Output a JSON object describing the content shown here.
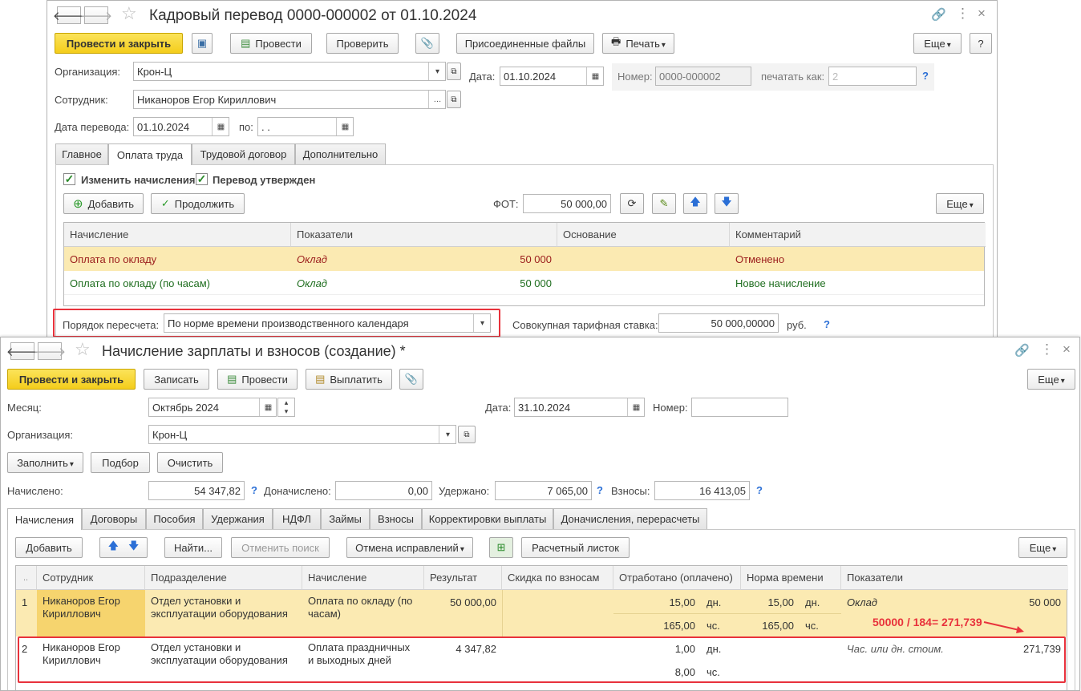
{
  "w1": {
    "title": "Кадровый перевод 0000-000002 от 01.10.2024",
    "toolbar": {
      "post_close": "Провести и закрыть",
      "post": "Провести",
      "check": "Проверить",
      "attached": "Присоединенные файлы",
      "print": "Печать",
      "more": "Еще",
      "help": "?"
    },
    "org_label": "Организация:",
    "org_value": "Крон-Ц",
    "date_label": "Дата:",
    "date_value": "01.10.2024",
    "number_label": "Номер:",
    "number_value": "0000-000002",
    "print_as_label": "печатать как:",
    "print_as_value": "2",
    "employee_label": "Сотрудник:",
    "employee_value": "Никаноров Егор Кириллович",
    "transfer_date_label": "Дата перевода:",
    "transfer_date_value": "01.10.2024",
    "to_label": "по:",
    "to_value": "  .  .",
    "tabs": [
      "Главное",
      "Оплата труда",
      "Трудовой договор",
      "Дополнительно"
    ],
    "change_accruals": "Изменить начисления",
    "transfer_approved": "Перевод утвержден",
    "add": "Добавить",
    "continue": "Продолжить",
    "fot_label": "ФОТ:",
    "fot_value": "50 000,00",
    "more": "Еще",
    "columns": [
      "Начисление",
      "Показатели",
      "Основание",
      "Комментарий"
    ],
    "rows": [
      {
        "accrual": "Оплата по окладу",
        "indicator": "Оклад",
        "amount": "50 000",
        "basis": "",
        "comment": "Отменено",
        "color": "#9b1c1c"
      },
      {
        "accrual": "Оплата по окладу (по часам)",
        "indicator": "Оклад",
        "amount": "50 000",
        "basis": "",
        "comment": "Новое начисление",
        "color": "#1f6e1f"
      }
    ],
    "recalc_label": "Порядок пересчета:",
    "recalc_value": "По норме времени производственного календаря",
    "rate_label": "Совокупная тарифная ставка:",
    "rate_value": "50 000,00000",
    "rate_unit": "руб.",
    "help": "?"
  },
  "w2": {
    "title": "Начисление зарплаты и взносов (создание) *",
    "toolbar": {
      "post_close": "Провести и закрыть",
      "save": "Записать",
      "post": "Провести",
      "pay": "Выплатить",
      "more": "Еще"
    },
    "month_label": "Месяц:",
    "month_value": "Октябрь 2024",
    "date_label": "Дата:",
    "date_value": "31.10.2024",
    "number_label": "Номер:",
    "number_value": "",
    "org_label": "Организация:",
    "org_value": "Крон-Ц",
    "fill": "Заполнить",
    "select": "Подбор",
    "clear": "Очистить",
    "accrued_label": "Начислено:",
    "accrued_value": "54 347,82",
    "extra_label": "Доначислено:",
    "extra_value": "0,00",
    "withheld_label": "Удержано:",
    "withheld_value": "7 065,00",
    "contrib_label": "Взносы:",
    "contrib_value": "16 413,05",
    "help": "?",
    "tabs": [
      "Начисления",
      "Договоры",
      "Пособия",
      "Удержания",
      "НДФЛ",
      "Займы",
      "Взносы",
      "Корректировки выплаты",
      "Доначисления, перерасчеты"
    ],
    "add": "Добавить",
    "find": "Найти...",
    "cancel_search": "Отменить поиск",
    "cancel_corrections": "Отмена исправлений",
    "payslip": "Расчетный листок",
    "more": "Еще",
    "columns": [
      "..",
      "Сотрудник",
      "Подразделение",
      "Начисление",
      "Результат",
      "Скидка по взносам",
      "Отработано (оплачено)",
      "Норма времени",
      "Показатели"
    ],
    "rows": [
      {
        "n": "1",
        "employee": "Никаноров Егор Кириллович",
        "dept": "Отдел установки и эксплуатации оборудования",
        "accrual": "Оплата по окладу (по часам)",
        "result": "50 000,00",
        "worked_days": "15,00",
        "days_unit": "дн.",
        "worked_hours": "165,00",
        "hours_unit": "чс.",
        "norm_days": "15,00",
        "norm_days_unit": "дн.",
        "norm_hours": "165,00",
        "norm_hours_unit": "чс.",
        "indicator": "Оклад",
        "indicator_value": "50 000"
      },
      {
        "n": "2",
        "employee": "Никаноров Егор Кириллович",
        "dept": "Отдел установки и эксплуатации оборудования",
        "accrual": "Оплата праздничных и выходных дней",
        "result": "4 347,82",
        "worked_days": "1,00",
        "days_unit": "дн.",
        "worked_hours": "8,00",
        "hours_unit": "чс.",
        "indicator": "Час. или дн. стоим.",
        "indicator_value": "271,739"
      }
    ],
    "annotation": "50000 / 184= 271,739"
  }
}
